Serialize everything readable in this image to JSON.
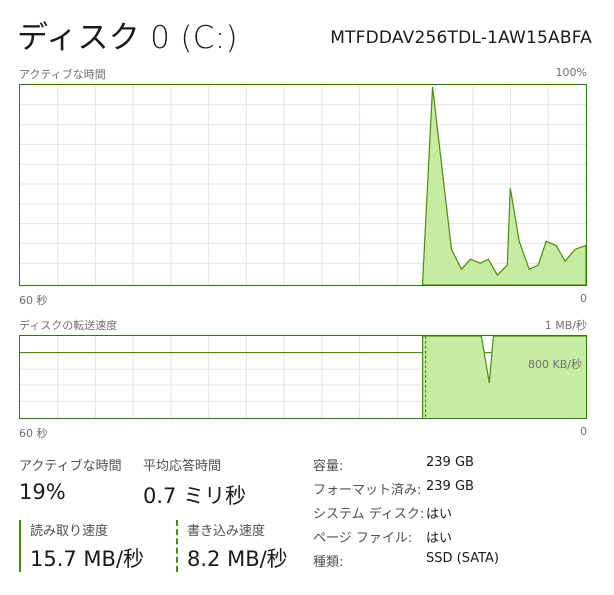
{
  "header": {
    "title": "ディスク 0 (C:)",
    "model": "MTFDDAV256TDL-1AW15ABFA"
  },
  "active_time_chart": {
    "label": "アクティブな時間",
    "max_label": "100%",
    "left_axis_label": "60 秒",
    "right_axis_label": "0",
    "line_color": "#4f8a10",
    "fill_color": "#c6eca2"
  },
  "transfer_chart": {
    "label": "ディスクの転送速度",
    "max_label": "1 MB/秒",
    "reference_label": "800 KB/秒",
    "left_axis_label": "60 秒",
    "right_axis_label": "0",
    "line_color": "#4f8a10",
    "fill_color": "#c6eca2"
  },
  "stats": {
    "active_time_label": "アクティブな時間",
    "active_time_value": "19%",
    "avg_response_label": "平均応答時間",
    "avg_response_value": "0.7 ミリ秒",
    "read_speed_label": "読み取り速度",
    "read_speed_value": "15.7 MB/秒",
    "write_speed_label": "書き込み速度",
    "write_speed_value": "8.2 MB/秒"
  },
  "properties": [
    {
      "label": "容量:",
      "value": "239 GB"
    },
    {
      "label": "フォーマット済み:",
      "value": "239 GB"
    },
    {
      "label": "システム ディスク:",
      "value": "はい"
    },
    {
      "label": "ページ ファイル:",
      "value": "はい"
    },
    {
      "label": "種類:",
      "value": "SSD (SATA)"
    }
  ]
}
